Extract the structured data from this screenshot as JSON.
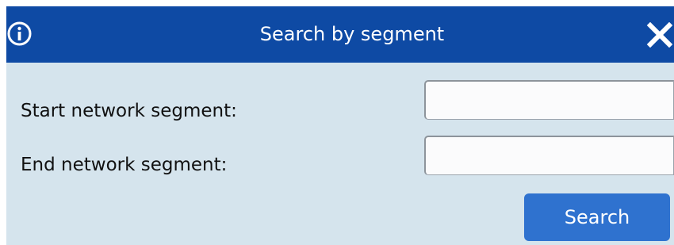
{
  "dialog": {
    "title": "Search by segment",
    "info_icon": "info-circle-icon",
    "close_icon": "close-x-icon",
    "background_color": "#d5e4ed",
    "titlebar_color": "#0e4aa4"
  },
  "form": {
    "start_label": "Start network segment:",
    "start_value": "",
    "end_label": "End network segment:",
    "end_value": "",
    "search_label": "Search",
    "button_color": "#2f72cf"
  }
}
